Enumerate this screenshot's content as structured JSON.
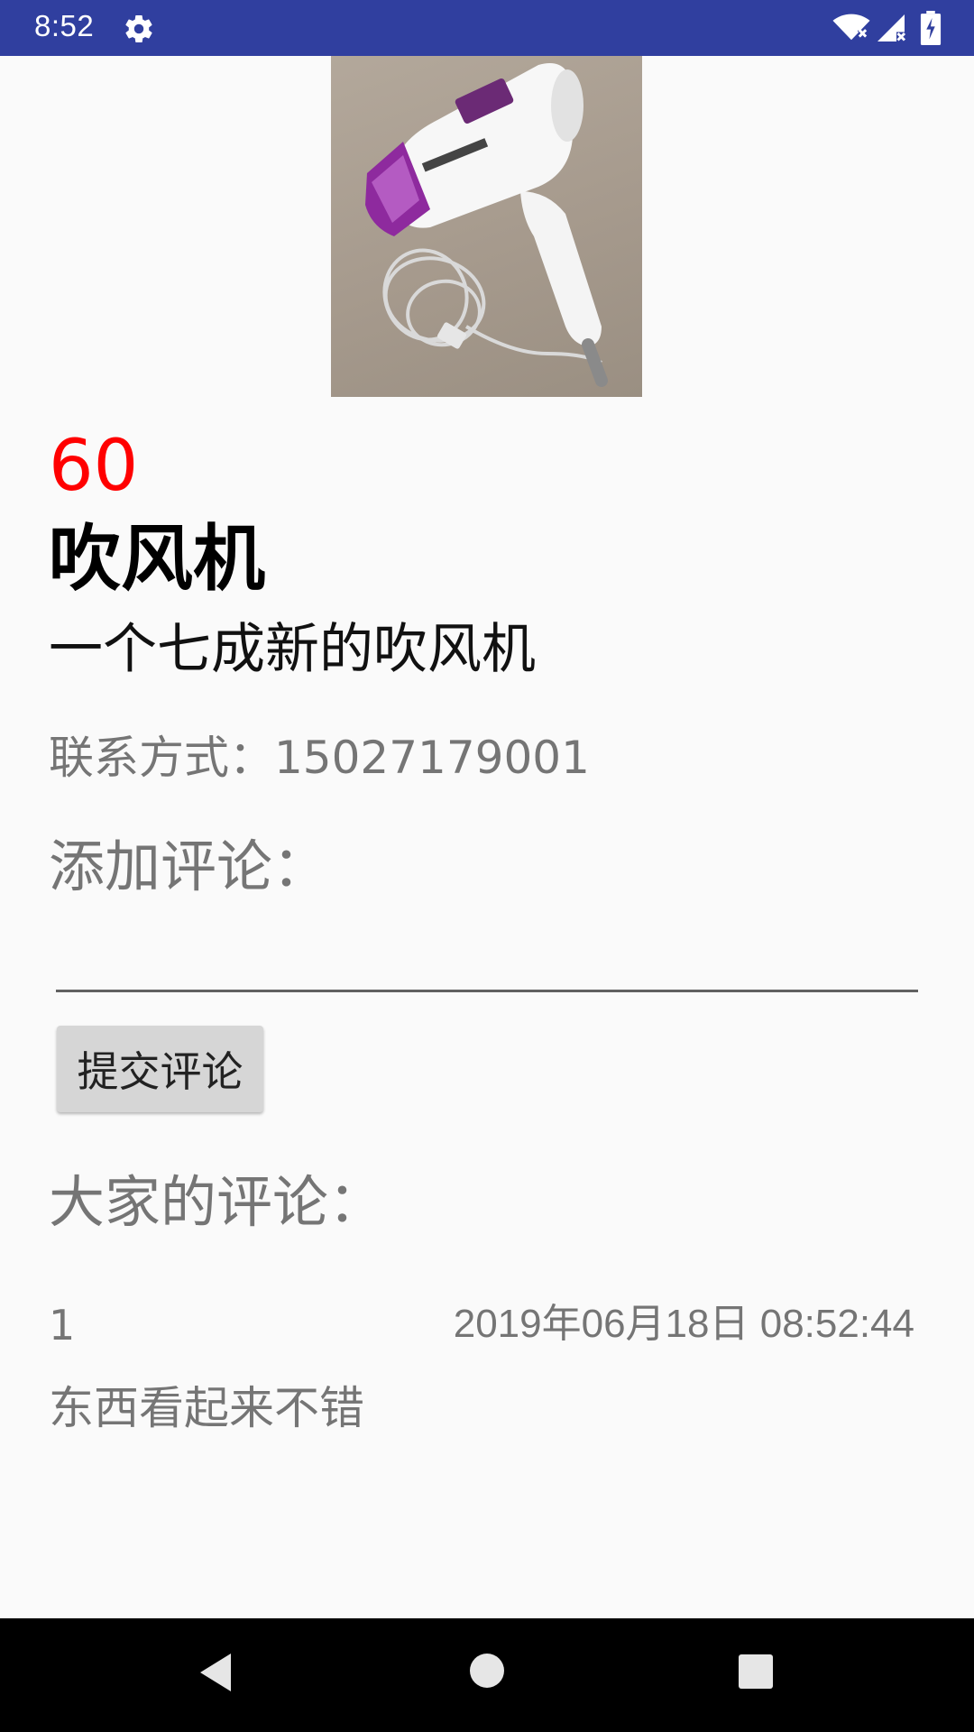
{
  "status_bar": {
    "time": "8:52",
    "icons": [
      "gear-icon",
      "wifi-icon",
      "signal-icon",
      "battery-icon"
    ],
    "background_color": "#303f9f"
  },
  "product": {
    "image_icon": "hair-dryer-photo",
    "price": "60",
    "price_color": "#ff0000",
    "name": "吹风机",
    "description": "一个七成新的吹风机",
    "contact": "联系方式：15027179001"
  },
  "comment_form": {
    "label": "添加评论：",
    "input_value": "",
    "input_placeholder": "",
    "submit_label": "提交评论"
  },
  "comments": {
    "heading": "大家的评论：",
    "items": [
      {
        "user": "1",
        "time": "2019年06月18日 08:52:44",
        "text": "东西看起来不错"
      }
    ]
  },
  "nav_bar": {
    "icons": [
      "back-icon",
      "home-icon",
      "recents-icon"
    ]
  }
}
